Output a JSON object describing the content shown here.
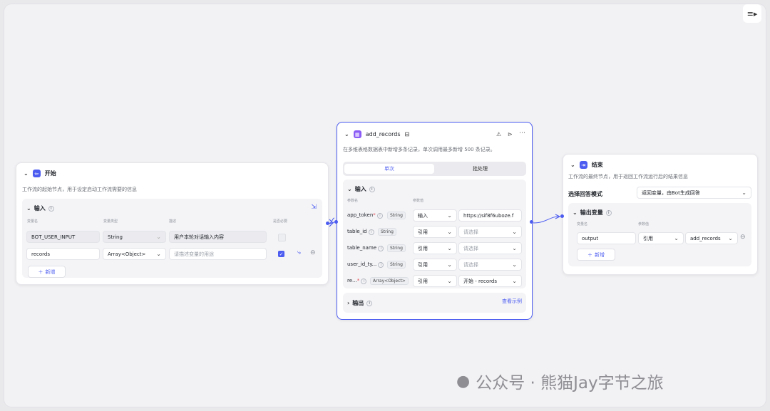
{
  "start": {
    "title": "开始",
    "desc": "工作流的起始节点，用于设定启动工作流需要的信息",
    "input_title": "输入",
    "col_name": "变量名",
    "col_type": "变量类型",
    "col_desc": "描述",
    "col_required": "是否必要",
    "rows": [
      {
        "name": "BOT_USER_INPUT",
        "type": "String",
        "desc": "用户本轮对话输入内容",
        "desc_placeholder": ""
      },
      {
        "name": "records",
        "type": "Array<Object>",
        "desc": "",
        "desc_placeholder": "请描述变量的用途"
      }
    ],
    "add_label": "新增"
  },
  "add_records": {
    "title": "add_records",
    "desc": "在多维表格数据表中新增多条记录，单次调用最多新增 500 条记录。",
    "tabs": [
      "单次",
      "批处理"
    ],
    "input_title": "输入",
    "col_param": "参数名",
    "col_value": "参数值",
    "params": [
      {
        "name": "app_token",
        "required": "*",
        "type": "String",
        "mode": "输入",
        "value": "https://sif8f6uboze.f",
        "placeholder": ""
      },
      {
        "name": "table_id",
        "required": "",
        "type": "String",
        "mode": "引用",
        "value": "",
        "placeholder": "请选择"
      },
      {
        "name": "table_name",
        "required": "",
        "type": "String",
        "mode": "引用",
        "value": "",
        "placeholder": "请选择"
      },
      {
        "name": "user_id_ty...",
        "required": "",
        "type": "String",
        "mode": "引用",
        "value": "",
        "placeholder": "请选择"
      },
      {
        "name": "re...",
        "required": "*",
        "type": "Array<Object>",
        "mode": "引用",
        "value": "开始 - records",
        "placeholder": ""
      }
    ],
    "output_title": "输出",
    "example_link": "查看示例"
  },
  "end": {
    "title": "结束",
    "desc": "工作流的最终节点，用于返回工作流运行后的结果信息",
    "mode_label": "选择回答模式",
    "mode_value": "返回变量，由Bot生成回答",
    "output_title": "输出变量",
    "col_name": "变量名",
    "col_value": "参数值",
    "rows": [
      {
        "name": "output",
        "mode": "引用",
        "value": "add_records"
      }
    ],
    "add_label": "新增"
  },
  "watermark": "公众号 · 熊猫Jay字节之旅",
  "colors": {
    "accent": "#4c5cf0",
    "canvas": "#f2f2f5"
  }
}
